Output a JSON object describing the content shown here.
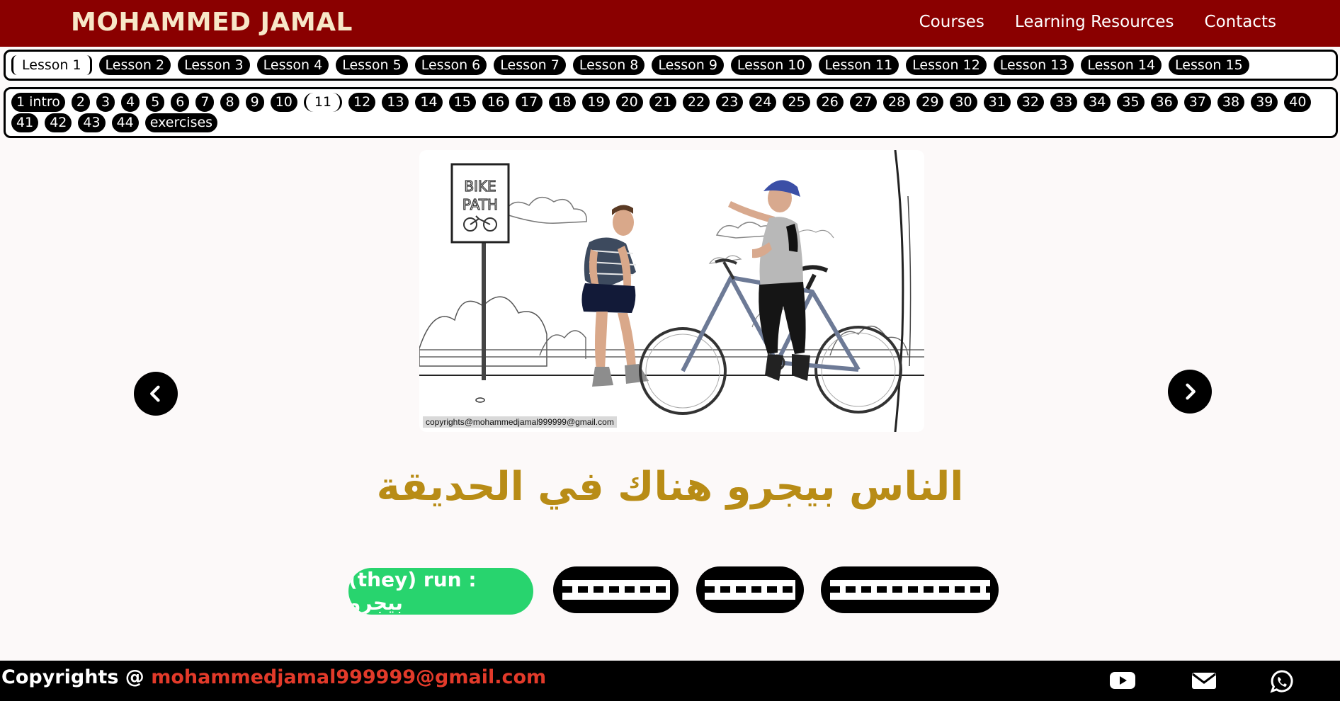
{
  "header": {
    "brand": "MOHAMMED JAMAL",
    "nav": [
      "Courses",
      "Learning Resources",
      "Contacts"
    ]
  },
  "lessons": {
    "active_index": 0,
    "items": [
      "Lesson 1",
      "Lesson 2",
      "Lesson 3",
      "Lesson 4",
      "Lesson 5",
      "Lesson 6",
      "Lesson 7",
      "Lesson 8",
      "Lesson 9",
      "Lesson 10",
      "Lesson 11",
      "Lesson 12",
      "Lesson 13",
      "Lesson 14",
      "Lesson 15"
    ]
  },
  "pages": {
    "active_index": 10,
    "items": [
      "1 intro",
      "2",
      "3",
      "4",
      "5",
      "6",
      "7",
      "8",
      "9",
      "10",
      "11",
      "12",
      "13",
      "14",
      "15",
      "16",
      "17",
      "18",
      "19",
      "20",
      "21",
      "22",
      "23",
      "24",
      "25",
      "26",
      "27",
      "28",
      "29",
      "30",
      "31",
      "32",
      "33",
      "34",
      "35",
      "36",
      "37",
      "38",
      "39",
      "40",
      "41",
      "42",
      "43",
      "44",
      "exercises"
    ]
  },
  "slide": {
    "sign_line1": "BIKE",
    "sign_line2": "PATH",
    "copyright_tag": "copyrights@mohammedjamal999999@gmail.com",
    "sentence": "الناس بيجرو هناك في الحديقة",
    "revealed_word": "(they) run : بيجرو"
  },
  "footer": {
    "copyright_prefix": "Copyrights @ ",
    "email": "mohammedjamal999999@gmail.com",
    "icons": [
      "youtube-icon",
      "mail-icon",
      "whatsapp-icon"
    ]
  },
  "colors": {
    "header_bg": "#8a0000",
    "brand_text": "#f7e7c8",
    "sentence": "#b88c16",
    "revealed_chip": "#28d46e",
    "footer_email": "#e23a2a"
  }
}
